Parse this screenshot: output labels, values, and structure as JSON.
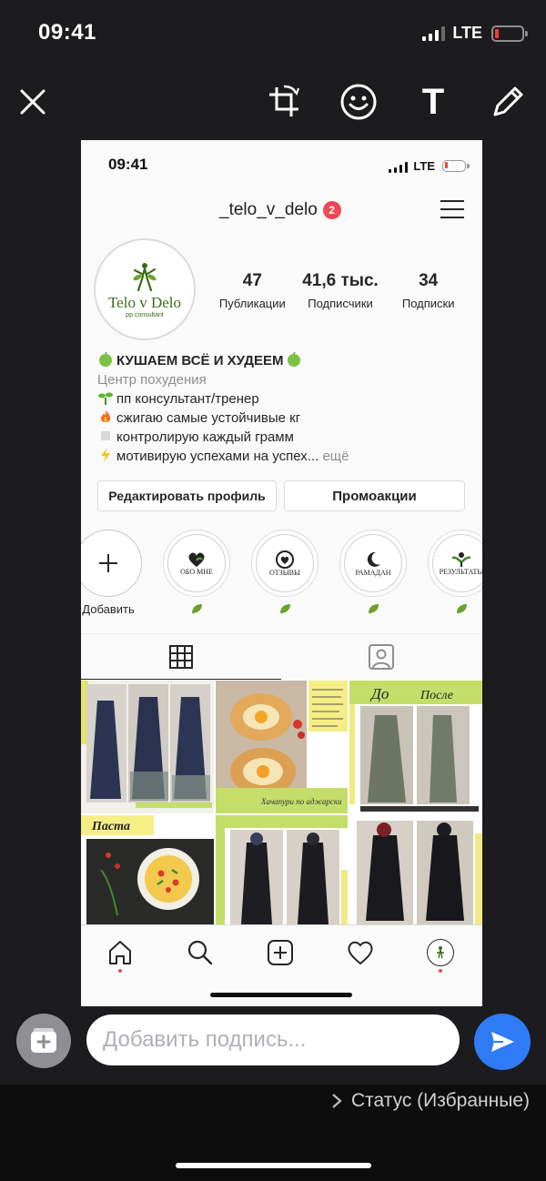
{
  "os": {
    "time": "09:41",
    "network": "LTE"
  },
  "toolbar": {
    "close": "close-icon",
    "crop": "crop-rotate-icon",
    "sticker": "smiley-icon",
    "text": "T",
    "draw": "pencil-icon"
  },
  "screenshot": {
    "status": {
      "time": "09:41",
      "network": "LTE"
    },
    "profile": {
      "username": "_telo_v_delo",
      "notifications": "2",
      "logo_text": "Telo v Delo",
      "logo_sub": "pp consultant",
      "stats": [
        {
          "value": "47",
          "label": "Публикации"
        },
        {
          "value": "41,6 тыс.",
          "label": "Подписчики"
        },
        {
          "value": "34",
          "label": "Подписки"
        }
      ],
      "bio": {
        "name": "КУШАЕМ ВСЁ И ХУДЕЕМ",
        "category": "Центр похудения",
        "lines": [
          "пп консультант/тренер",
          "сжигаю самые устойчивые кг",
          "контролирую каждый грамм",
          "мотивирую успехами на успех..."
        ],
        "more": "ещё"
      },
      "edit_button": "Редактировать профиль",
      "promo_button": "Промоакции",
      "highlights": [
        {
          "label": "Добавить",
          "title": "+"
        },
        {
          "label": "",
          "title": "ОБО МНЕ"
        },
        {
          "label": "",
          "title": "ОТЗЫВЫ"
        },
        {
          "label": "",
          "title": "РАМАДАН"
        },
        {
          "label": "",
          "title": "РЕЗУЛЬТАТЫ"
        }
      ],
      "posts": {
        "p3_before": "До",
        "p3_after": "После",
        "p2_caption": "Хачапури по аджарски",
        "p4_title": "Паста"
      }
    }
  },
  "caption": {
    "placeholder": "Добавить подпись..."
  },
  "status_link": "Статус (Избранные)",
  "colors": {
    "accent": "#2f7cf6",
    "badge": "#ed4956",
    "brand_green": "#3c6b1b"
  }
}
